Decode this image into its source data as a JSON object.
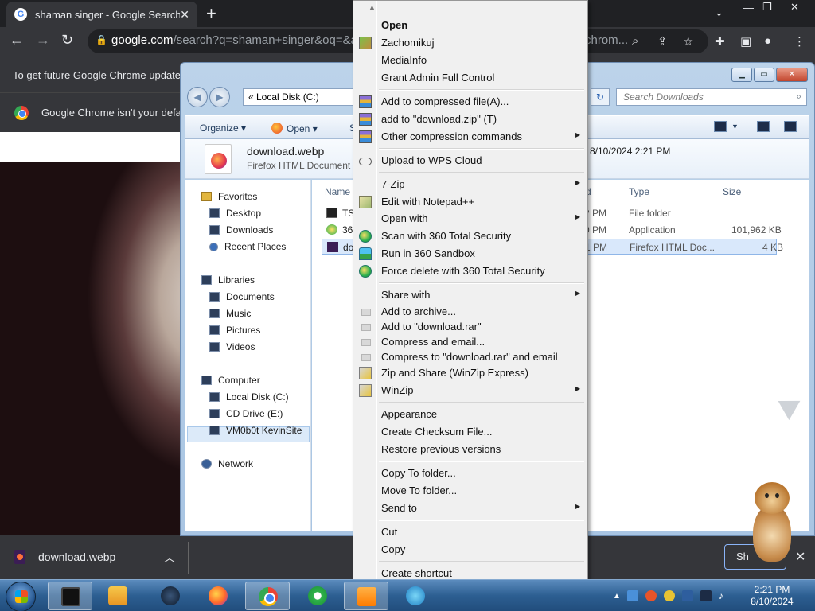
{
  "browser": {
    "tab_title": "shaman singer - Google Search",
    "url_host": "google.com",
    "url_path": "/search?q=shaman+singer&oq=&aq",
    "url_tail": "chrom...",
    "infobar_text": "To get future Google Chrome update",
    "default_browser_text": "Google Chrome isn't your defa",
    "download_file": "download.webp",
    "show_all_label": "Sh"
  },
  "explorer": {
    "address": "« Local Disk (C:)",
    "search_placeholder": "Search Downloads",
    "cmd_organize": "Organize ▾",
    "cmd_open": "Open ▾",
    "cmd_s": "S",
    "detail_name": "download.webp",
    "detail_type": "Firefox HTML Document",
    "detail_date": "8/10/2024 2:21 PM",
    "nav": {
      "favorites": "Favorites",
      "desktop": "Desktop",
      "downloads": "Downloads",
      "recent": "Recent Places",
      "libraries": "Libraries",
      "documents": "Documents",
      "music": "Music",
      "pictures": "Pictures",
      "videos": "Videos",
      "computer": "Computer",
      "local_disk": "Local Disk (C:)",
      "cd_drive": "CD Drive (E:)",
      "vm": "VM0b0t KevinSite",
      "network": "Network"
    },
    "columns": {
      "name": "Name",
      "date_frag": "d",
      "type": "Type",
      "size": "Size"
    },
    "rows": [
      {
        "name": "TS",
        "time": "2 PM",
        "type": "File folder",
        "size": ""
      },
      {
        "name": "360",
        "time": "0 PM",
        "type": "Application",
        "size": "101,962 KB"
      },
      {
        "name": "do",
        "time": "1 PM",
        "type": "Firefox HTML Doc...",
        "size": "4 KB"
      }
    ]
  },
  "context_menu": {
    "open": "Open",
    "zachomikuj": "Zachomikuj",
    "mediainfo": "MediaInfo",
    "grant_admin": "Grant Admin Full Control",
    "add_compressed": "Add to compressed file(A)...",
    "add_zip": "add to \"download.zip\" (T)",
    "other_compression": "Other compression commands",
    "upload_wps": "Upload to WPS Cloud",
    "seven_zip": "7-Zip",
    "edit_notepad": "Edit with Notepad++",
    "open_with": "Open with",
    "scan_360": "Scan with 360 Total Security",
    "run_sandbox": "Run in 360 Sandbox",
    "force_delete": "Force delete with 360 Total Security",
    "share_with": "Share with",
    "add_archive": "Add to archive...",
    "add_rar": "Add to \"download.rar\"",
    "compress_email": "Compress and email...",
    "compress_rar_email": "Compress to \"download.rar\" and email",
    "zip_share": "Zip and Share (WinZip Express)",
    "winzip": "WinZip",
    "appearance": "Appearance",
    "checksum": "Create Checksum File...",
    "restore": "Restore previous versions",
    "copy_to": "Copy To folder...",
    "move_to": "Move To folder...",
    "send_to": "Send to",
    "cut": "Cut",
    "copy": "Copy",
    "create_shortcut": "Create shortcut"
  },
  "taskbar": {
    "time": "2:21 PM",
    "date": "8/10/2024"
  },
  "colors": {
    "chrome_dark": "#35363a",
    "menu_bg": "#f0f0f0",
    "taskbar": "#2d5f92"
  },
  "icons": [
    "google-g-icon",
    "lock-icon",
    "firefox-icon",
    "chrome-icon",
    "winrar-icon",
    "360-icon",
    "winzip-icon",
    "cloud-icon",
    "windows-start-icon"
  ]
}
